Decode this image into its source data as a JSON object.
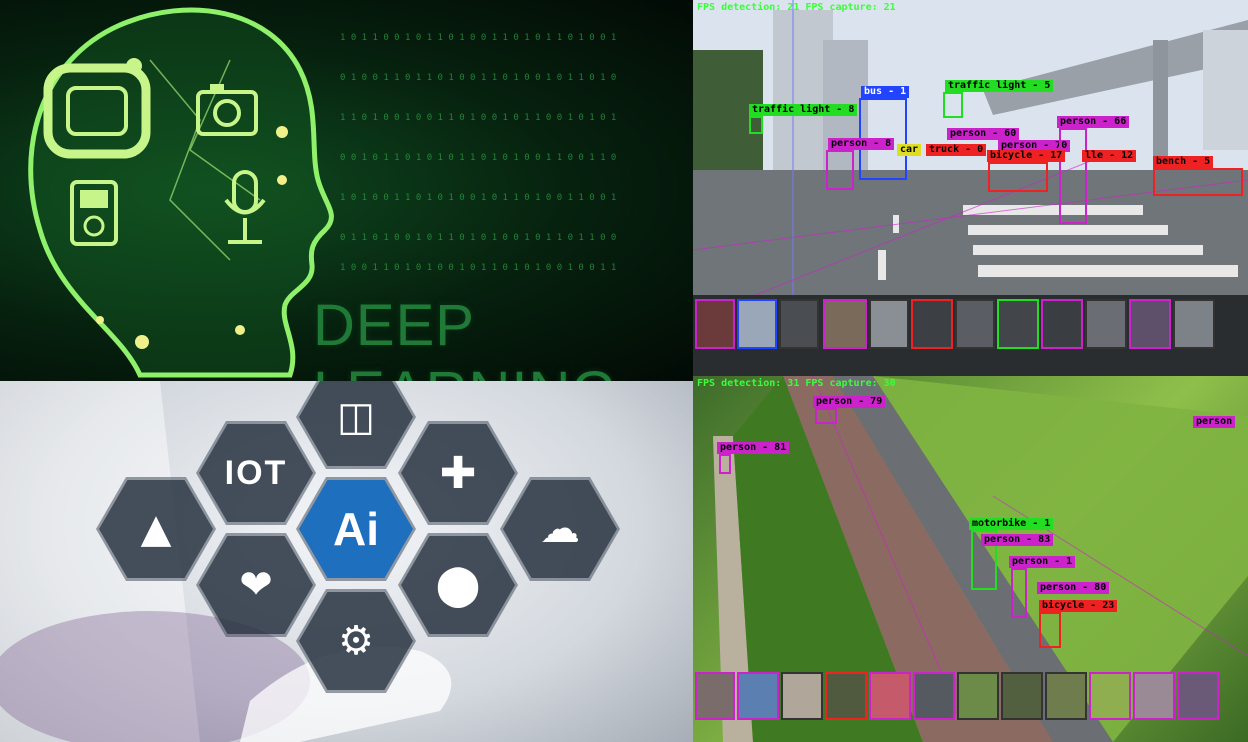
{
  "panels": {
    "top_left": {
      "title": "DEEP LEARNING",
      "icons": [
        "head-silhouette-icon",
        "monitor-icon",
        "camera-icon",
        "music-player-icon",
        "microphone-icon",
        "binary-rain-icon"
      ]
    },
    "top_right": {
      "hud": "FPS detection: 21 FPS capture: 21",
      "detections": [
        {
          "label": "traffic light - 5",
          "color": "#22dd22"
        },
        {
          "label": "traffic light - 8",
          "color": "#22dd22"
        },
        {
          "label": "bus - 1",
          "color": "#2244ff"
        },
        {
          "label": "person - 60",
          "color": "#cc22cc"
        },
        {
          "label": "person - 70",
          "color": "#cc22cc"
        },
        {
          "label": "person - 66",
          "color": "#cc22cc"
        },
        {
          "label": "person - 8",
          "color": "#cc22cc"
        },
        {
          "label": "truck - 0",
          "color": "#ee2222"
        },
        {
          "label": "bicycle - 17",
          "color": "#ee2222"
        },
        {
          "label": "lle - 12",
          "color": "#ee2222"
        },
        {
          "label": "bench - 5",
          "color": "#ee2222"
        },
        {
          "label": "car",
          "color": "#dddd22"
        }
      ]
    },
    "bottom_left": {
      "center_label": "Ai",
      "iot_label": "IOT",
      "icons": [
        "database-icon",
        "graduation-cap-icon",
        "medical-shield-icon",
        "cloud-upload-icon",
        "apple-heart-icon",
        "pills-icon",
        "laptop-gears-icon",
        "gear-icon"
      ]
    },
    "bottom_right": {
      "hud": "FPS detection: 31 FPS capture: 30",
      "detections": [
        {
          "label": "person - 79",
          "color": "#cc22cc"
        },
        {
          "label": "person - 81",
          "color": "#cc22cc"
        },
        {
          "label": "person",
          "color": "#cc22cc"
        },
        {
          "label": "motorbike - 1",
          "color": "#22dd22"
        },
        {
          "label": "person - 83",
          "color": "#cc22cc"
        },
        {
          "label": "person - 1",
          "color": "#cc22cc"
        },
        {
          "label": "person - 80",
          "color": "#cc22cc"
        },
        {
          "label": "bicycle - 23",
          "color": "#ee2222"
        }
      ]
    }
  }
}
